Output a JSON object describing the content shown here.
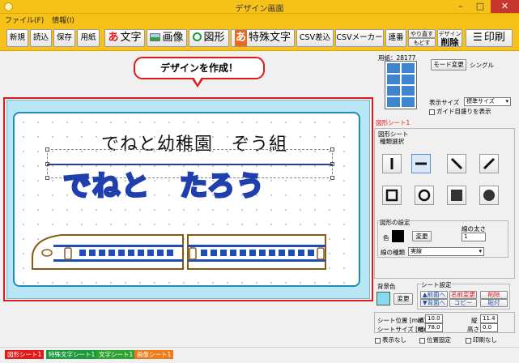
{
  "window": {
    "title": "デザイン画面",
    "minimize": "–",
    "maximize": "□",
    "close": "✕"
  },
  "menu": [
    "ファイル(F)",
    "情報(I)"
  ],
  "toolbar": {
    "new": "新規",
    "load": "読込",
    "save": "保存",
    "paper": "用紙",
    "text_icon": "あ",
    "text": "文字",
    "image": "画像",
    "shape": "図形",
    "special_icon": "あ",
    "special_text": "特殊文字",
    "csv_merge": "CSV差込",
    "csv_maker": "CSVメーカー",
    "serial": "連番",
    "redo": "やり直す",
    "undo": "もどす",
    "delete_hint": "デザイン",
    "delete": "削除",
    "print": "印刷"
  },
  "callout": "デザインを作成！",
  "canvas": {
    "line1": "でねと幼稚園　ぞう組",
    "line2": "でねと　たろう"
  },
  "right": {
    "paper_label": "用紙：28177",
    "mode_change": "モード変更",
    "mode_value": "シングル",
    "display_size_label": "表示サイズ",
    "display_size_value": "標準サイズ",
    "guide_label": "ガイド目盛りを表示",
    "sheet_name": "図形シート1",
    "shape_sheet_label": "図形シート",
    "shape_type_label": "種類選択",
    "shape_settings_label": "図形の設定",
    "color_label": "色",
    "change": "変更",
    "line_width_label": "線の太さ",
    "line_width_value": "1",
    "line_type_label": "線の種類",
    "line_type_value": "実線",
    "bg_color_label": "背景色",
    "bg_change": "変更",
    "sheet_settings_label": "シート設定",
    "to_front": "▲前面へ",
    "to_back": "▼背面へ",
    "rename": "名前変更",
    "copy": "コピー",
    "remove": "削除",
    "paste": "貼付",
    "sheet_pos_label": "シート位置 [mm]",
    "pos_x_label": "横",
    "pos_x": "10.0",
    "pos_y_label": "縦",
    "pos_y": "11.4",
    "sheet_size_label": "シートサイズ [mm]",
    "width_label": "幅",
    "width": "78.0",
    "height_label": "高さ",
    "height": "0.0",
    "hide": "表示なし",
    "lock_pos": "位置固定",
    "no_print": "印刷なし"
  },
  "status_tabs": [
    {
      "label": "図形シート1",
      "color": "#e2191b"
    },
    {
      "label": "特殊文字シート1",
      "color": "#1a9a3a"
    },
    {
      "label": "文字シート1",
      "color": "#2fa32f"
    },
    {
      "label": "画像シート1",
      "color": "#f07b1a"
    }
  ]
}
